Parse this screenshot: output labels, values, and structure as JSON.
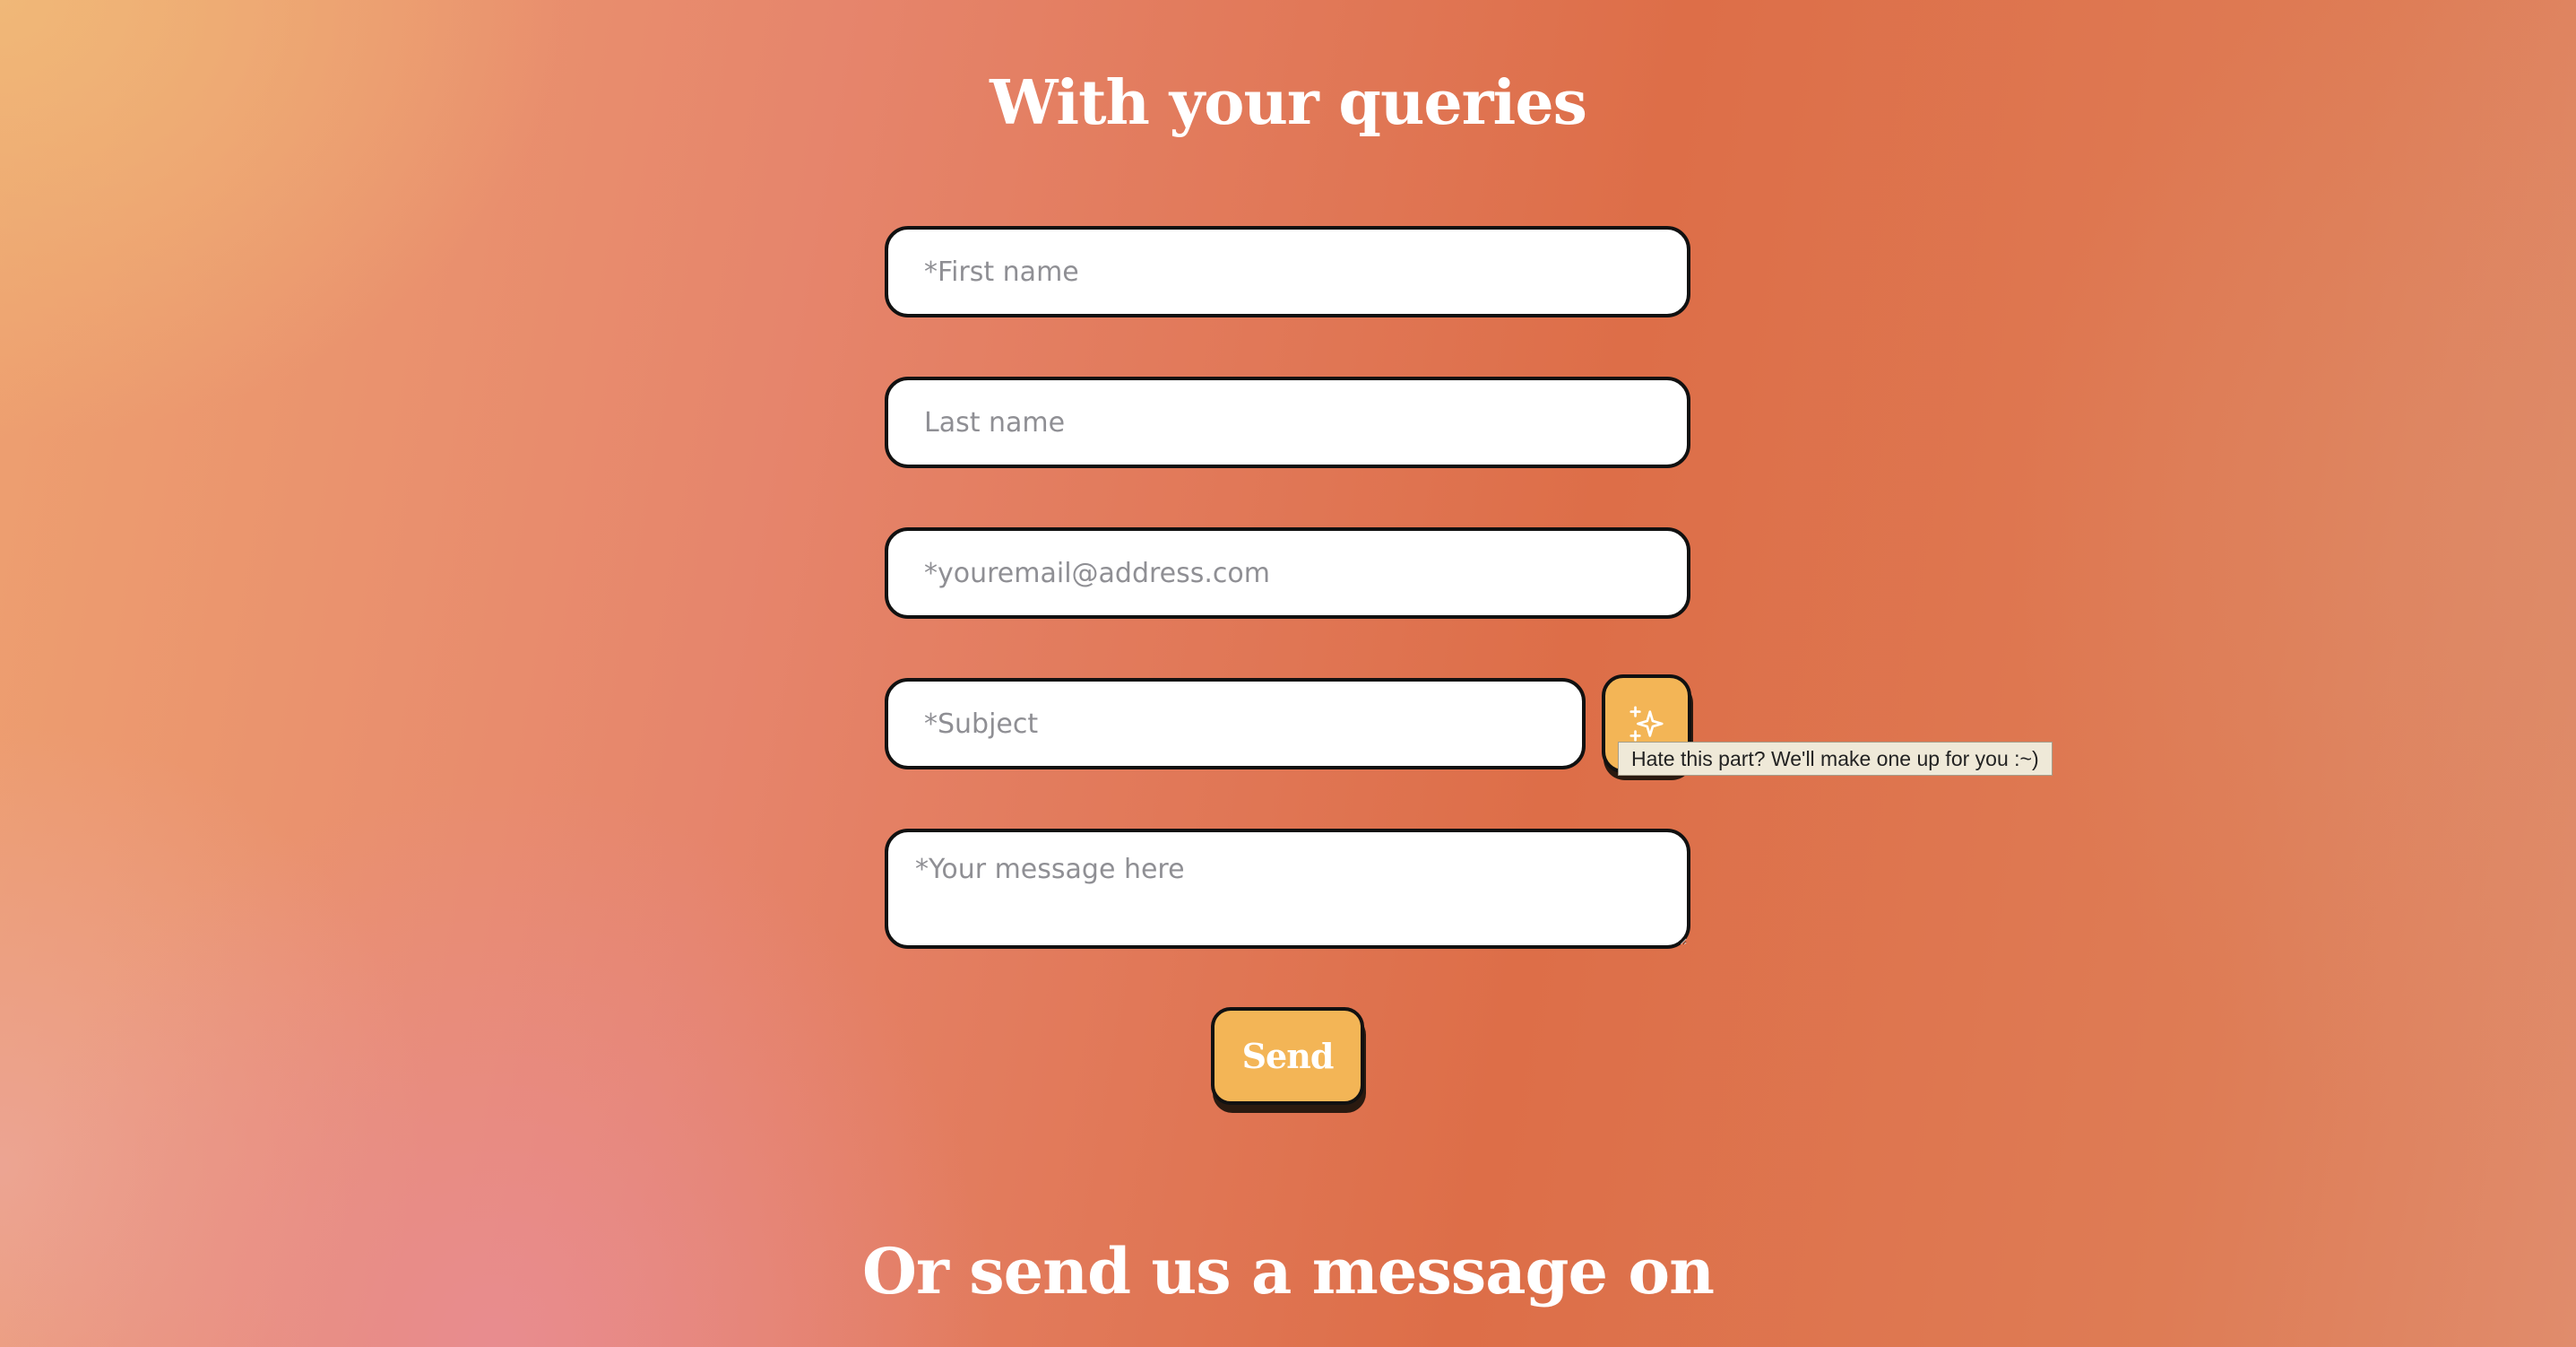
{
  "page": {
    "form_title": "With your queries",
    "footer_title": "Or send us a message on"
  },
  "form": {
    "first_name_placeholder": "*First name",
    "last_name_placeholder": "Last name",
    "email_placeholder": "*youremail@address.com",
    "subject_placeholder": "*Subject",
    "message_placeholder": "*Your message here",
    "magic_button_icon": "sparkles-icon",
    "magic_button_tooltip": "Hate this part? We'll make one up for you :~)",
    "send_label": "Send"
  },
  "colors": {
    "accent_button": "#f3b556",
    "border": "#111111",
    "tooltip_bg": "#efe9d8"
  }
}
